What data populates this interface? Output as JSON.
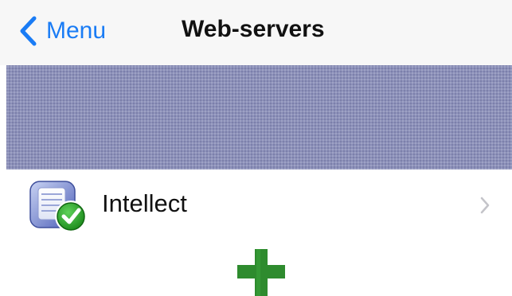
{
  "navbar": {
    "back_label": "Menu",
    "title": "Web-servers",
    "back_icon": "chevron-left-icon",
    "accent_color": "#1a7cf5"
  },
  "banner": {
    "color": "#8d91ba"
  },
  "servers": [
    {
      "name": "Intellect",
      "icon": "server-check-icon",
      "status": "connected",
      "disclosure_icon": "chevron-right-icon"
    }
  ],
  "add_button": {
    "icon": "plus-icon",
    "color": "#2e8b2e"
  }
}
